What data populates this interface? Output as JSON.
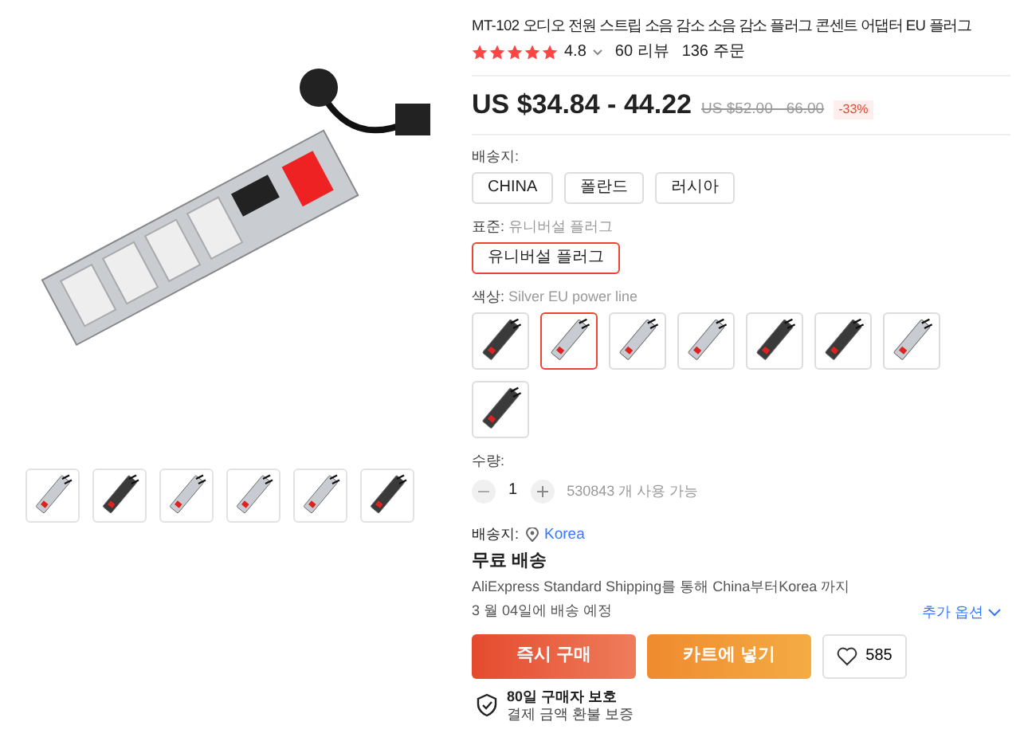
{
  "gallery": {
    "thumbnails": [
      {
        "kind": "silver",
        "selected": false
      },
      {
        "kind": "black",
        "selected": false
      },
      {
        "kind": "silver",
        "selected": false
      },
      {
        "kind": "silver",
        "selected": false
      },
      {
        "kind": "silver",
        "selected": false
      },
      {
        "kind": "black",
        "selected": false
      }
    ]
  },
  "product": {
    "title": "MT-102 오디오 전원 스트립 소음 감소 소음 감소 플러그 콘센트 어댑터 EU 플러그",
    "rating": {
      "stars": 5,
      "score": "4.8",
      "reviews": "60 리뷰",
      "orders": "136 주문"
    },
    "price": {
      "current": "US $34.84 - 44.22",
      "original": "US $52.00 - 66.00",
      "discount": "-33%"
    }
  },
  "ship_from": {
    "label": "배송지:",
    "options": [
      {
        "label": "CHINA",
        "selected": false
      },
      {
        "label": "폴란드",
        "selected": false
      },
      {
        "label": "러시아",
        "selected": false
      }
    ]
  },
  "standard": {
    "label": "표준:",
    "value": "유니버설 플러그",
    "options": [
      {
        "label": "유니버설 플러그",
        "selected": true
      }
    ]
  },
  "color": {
    "label": "색상:",
    "value": "Silver EU power line",
    "options": [
      {
        "kind": "black",
        "selected": false
      },
      {
        "kind": "silver",
        "selected": true
      },
      {
        "kind": "silver",
        "selected": false
      },
      {
        "kind": "silver",
        "selected": false
      },
      {
        "kind": "black",
        "selected": false
      },
      {
        "kind": "black",
        "selected": false
      },
      {
        "kind": "silver",
        "selected": false
      },
      {
        "kind": "black",
        "selected": false
      }
    ]
  },
  "quantity": {
    "label": "수량:",
    "value": "1",
    "available": "530843 개 사용 가능"
  },
  "deliver_to": {
    "label": "배송지:",
    "value": "Korea"
  },
  "shipping": {
    "title": "무료 배송",
    "detail": "AliExpress Standard Shipping를 통해 China부터Korea 까지",
    "date": "3 월 04일에 배송 예정",
    "more": "추가 옵션"
  },
  "actions": {
    "buy": "즉시 구매",
    "cart": "카트에 넣기",
    "wishlist": "585"
  },
  "protection": {
    "title": "80일 구매자 보호",
    "subtitle": "결제 금액 환불 보증"
  }
}
